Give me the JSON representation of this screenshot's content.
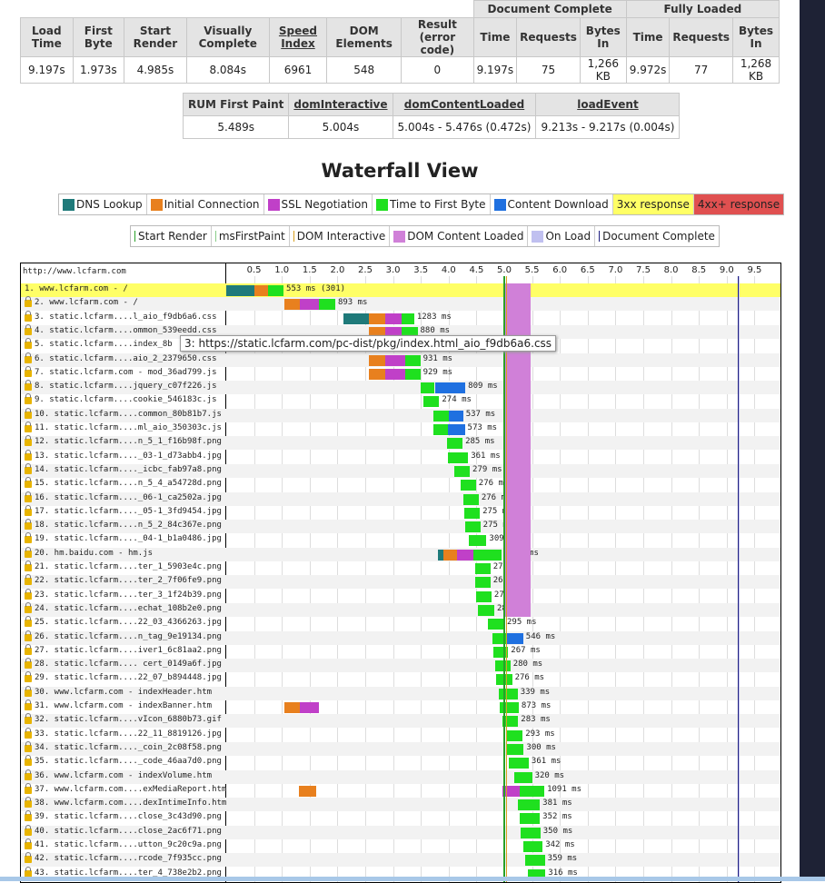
{
  "summary": {
    "group_headers": [
      "Document Complete",
      "Fully Loaded"
    ],
    "columns": [
      "Load Time",
      "First Byte",
      "Start Render",
      "Visually Complete",
      "Speed Index",
      "DOM Elements",
      "Result (error code)",
      "Time",
      "Requests",
      "Bytes In",
      "Time",
      "Requests",
      "Bytes In"
    ],
    "values": [
      "9.197s",
      "1.973s",
      "4.985s",
      "8.084s",
      "6961",
      "548",
      "0",
      "9.197s",
      "75",
      "1,266 KB",
      "9.972s",
      "77",
      "1,268 KB"
    ]
  },
  "rum": {
    "headers": [
      "RUM First Paint",
      "domInteractive",
      "domContentLoaded",
      "loadEvent"
    ],
    "values": [
      "5.489s",
      "5.004s",
      "5.004s - 5.476s (0.472s)",
      "9.213s - 9.217s (0.004s)"
    ]
  },
  "waterfall_title": "Waterfall View",
  "legend_timing": [
    {
      "label": "DNS Lookup",
      "color": "#1f7a7a"
    },
    {
      "label": "Initial Connection",
      "color": "#e8801e"
    },
    {
      "label": "SSL Negotiation",
      "color": "#c040c8"
    },
    {
      "label": "Time to First Byte",
      "color": "#1fe01f"
    },
    {
      "label": "Content Download",
      "color": "#1f70e0"
    },
    {
      "label": "3xx response",
      "color": "#ffff66"
    },
    {
      "label": "4xx+ response",
      "color": "#e05050"
    }
  ],
  "legend_events": [
    {
      "label": "Start Render",
      "color": "#28a028"
    },
    {
      "label": "msFirstPaint",
      "color": "#88cc88"
    },
    {
      "label": "DOM Interactive",
      "color": "#d8a020"
    },
    {
      "label": "DOM Content Loaded",
      "color": "#d080d8"
    },
    {
      "label": "On Load",
      "color": "#c0c0f0"
    },
    {
      "label": "Document Complete",
      "color": "#202080"
    }
  ],
  "waterfall": {
    "page_url": "http://www.lcfarm.com",
    "ticks": [
      "0.5",
      "1.0",
      "1.5",
      "2.0",
      "2.5",
      "3.0",
      "3.5",
      "4.0",
      "4.5",
      "5.0",
      "5.5",
      "6.0",
      "6.5",
      "7.0",
      "7.5",
      "8.0",
      "8.5",
      "9.0",
      "9.5"
    ],
    "events_s": {
      "start_render": 4.985,
      "dom_interactive": 5.004,
      "dom_content_loaded": [
        5.004,
        5.476
      ],
      "on_load": [
        9.213,
        9.217
      ],
      "document_complete": 9.197
    },
    "tooltip": "3: https://static.lcfarm.com/pc-dist/pkg/index.html_aio_f9db6a6.css",
    "rows": [
      {
        "label": "1. www.lcfarm.com - /",
        "duration": "553 ms (301)",
        "lock": false,
        "hi": true,
        "segs": [
          [
            0,
            0.5,
            "dns"
          ],
          [
            0.5,
            0.75,
            "conn"
          ],
          [
            0.75,
            1.03,
            "ttfb"
          ]
        ]
      },
      {
        "label": "2. www.lcfarm.com - /",
        "duration": "893 ms",
        "lock": true,
        "segs": [
          [
            1.05,
            1.33,
            "conn"
          ],
          [
            1.33,
            1.66,
            "ssl"
          ],
          [
            1.66,
            1.96,
            "ttfb"
          ]
        ]
      },
      {
        "label": "3. static.lcfarm....l_aio_f9db6a6.css",
        "duration": "1283 ms",
        "lock": true,
        "segs": [
          [
            2.1,
            2.56,
            "dns"
          ],
          [
            2.56,
            2.86,
            "conn"
          ],
          [
            2.86,
            3.16,
            "ssl"
          ],
          [
            3.16,
            3.38,
            "ttfb"
          ]
        ]
      },
      {
        "label": "4. static.lcfarm....ommon_539eedd.css",
        "duration": "880 ms",
        "lock": true,
        "segs": [
          [
            2.56,
            2.86,
            "conn"
          ],
          [
            2.86,
            3.16,
            "ssl"
          ],
          [
            3.16,
            3.44,
            "ttfb"
          ]
        ]
      },
      {
        "label": "5. static.lcfarm....index_8b",
        "duration": "",
        "lock": true,
        "segs": []
      },
      {
        "label": "6. static.lcfarm....aio_2_2379650.css",
        "duration": "931 ms",
        "lock": true,
        "segs": [
          [
            2.56,
            2.86,
            "conn"
          ],
          [
            2.86,
            3.22,
            "ssl"
          ],
          [
            3.22,
            3.49,
            "ttfb"
          ]
        ]
      },
      {
        "label": "7. static.lcfarm.com - mod_36ad799.js",
        "duration": "929 ms",
        "lock": true,
        "segs": [
          [
            2.56,
            2.86,
            "conn"
          ],
          [
            2.86,
            3.22,
            "ssl"
          ],
          [
            3.22,
            3.49,
            "ttfb"
          ]
        ]
      },
      {
        "label": "8. static.lcfarm....jquery_c07f226.js",
        "duration": "809 ms",
        "lock": true,
        "segs": [
          [
            3.5,
            3.75,
            "ttfb"
          ],
          [
            3.75,
            4.3,
            "download"
          ]
        ]
      },
      {
        "label": "9. static.lcfarm....cookie_546183c.js",
        "duration": "274 ms",
        "lock": true,
        "segs": [
          [
            3.55,
            3.83,
            "ttfb"
          ]
        ]
      },
      {
        "label": "10. static.lcfarm....common_80b81b7.js",
        "duration": "537 ms",
        "lock": true,
        "segs": [
          [
            3.72,
            4.0,
            "ttfb"
          ],
          [
            4.0,
            4.26,
            "download"
          ]
        ]
      },
      {
        "label": "11. static.lcfarm....ml_aio_350303c.js",
        "duration": "573 ms",
        "lock": true,
        "segs": [
          [
            3.72,
            3.98,
            "ttfb"
          ],
          [
            3.98,
            4.29,
            "download"
          ]
        ]
      },
      {
        "label": "12. static.lcfarm....n_5_1_f16b98f.png",
        "duration": "285 ms",
        "lock": true,
        "segs": [
          [
            3.97,
            4.25,
            "ttfb"
          ]
        ]
      },
      {
        "label": "13. static.lcfarm...._03-1_d73abb4.jpg",
        "duration": "361 ms",
        "lock": true,
        "segs": [
          [
            3.99,
            4.35,
            "ttfb"
          ]
        ]
      },
      {
        "label": "14. static.lcfarm...._icbc_fab97a8.png",
        "duration": "279 ms",
        "lock": true,
        "segs": [
          [
            4.1,
            4.38,
            "ttfb"
          ]
        ]
      },
      {
        "label": "15. static.lcfarm....n_5_4_a54728d.png",
        "duration": "276 ms",
        "lock": true,
        "segs": [
          [
            4.21,
            4.49,
            "ttfb"
          ]
        ]
      },
      {
        "label": "16. static.lcfarm...._06-1_ca2502a.jpg",
        "duration": "276 ms",
        "lock": true,
        "segs": [
          [
            4.26,
            4.54,
            "ttfb"
          ]
        ]
      },
      {
        "label": "17. static.lcfarm...._05-1_3fd9454.jpg",
        "duration": "275 ms",
        "lock": true,
        "segs": [
          [
            4.28,
            4.56,
            "ttfb"
          ]
        ]
      },
      {
        "label": "18. static.lcfarm....n_5_2_84c367e.png",
        "duration": "275 ms",
        "lock": true,
        "segs": [
          [
            4.29,
            4.57,
            "ttfb"
          ]
        ]
      },
      {
        "label": "19. static.lcfarm...._04-1_b1a0486.jpg",
        "duration": "309 ms",
        "lock": true,
        "segs": [
          [
            4.37,
            4.68,
            "ttfb"
          ]
        ]
      },
      {
        "label": "20. hm.baidu.com - hm.js",
        "duration": "1120 ms",
        "lock": true,
        "segs": [
          [
            3.8,
            3.9,
            "dns"
          ],
          [
            3.9,
            4.15,
            "conn"
          ],
          [
            4.15,
            4.45,
            "ssl"
          ],
          [
            4.45,
            4.95,
            "ttfb"
          ]
        ]
      },
      {
        "label": "21. static.lcfarm....ter_1_5903e4c.png",
        "duration": "279 ms",
        "lock": true,
        "segs": [
          [
            4.47,
            4.75,
            "ttfb"
          ]
        ]
      },
      {
        "label": "22. static.lcfarm....ter_2_7f06fe9.png",
        "duration": "268 ms",
        "lock": true,
        "segs": [
          [
            4.48,
            4.75,
            "ttfb"
          ]
        ]
      },
      {
        "label": "23. static.lcfarm....ter_3_1f24b39.png",
        "duration": "270 ms",
        "lock": true,
        "segs": [
          [
            4.5,
            4.77,
            "ttfb"
          ]
        ]
      },
      {
        "label": "24. static.lcfarm....echat_108b2e0.png",
        "duration": "287 ms",
        "lock": true,
        "segs": [
          [
            4.53,
            4.82,
            "ttfb"
          ]
        ]
      },
      {
        "label": "25. static.lcfarm....22_03_4366263.jpg",
        "duration": "295 ms",
        "lock": true,
        "segs": [
          [
            4.7,
            5.0,
            "ttfb"
          ]
        ]
      },
      {
        "label": "26. static.lcfarm....n_tag_9e19134.png",
        "duration": "546 ms",
        "lock": true,
        "segs": [
          [
            4.79,
            5.04,
            "ttfb"
          ],
          [
            5.04,
            5.34,
            "download"
          ]
        ]
      },
      {
        "label": "27. static.lcfarm....iver1_6c81aa2.png",
        "duration": "267 ms",
        "lock": true,
        "segs": [
          [
            4.8,
            5.07,
            "ttfb"
          ]
        ]
      },
      {
        "label": "28. static.lcfarm.... cert_0149a6f.jpg",
        "duration": "280 ms",
        "lock": true,
        "segs": [
          [
            4.83,
            5.11,
            "ttfb"
          ]
        ]
      },
      {
        "label": "29. static.lcfarm....22_07_b894448.jpg",
        "duration": "276 ms",
        "lock": true,
        "segs": [
          [
            4.86,
            5.14,
            "ttfb"
          ]
        ]
      },
      {
        "label": "30. www.lcfarm.com - indexHeader.htm",
        "duration": "339 ms",
        "lock": true,
        "segs": [
          [
            4.9,
            5.24,
            "ttfb"
          ]
        ]
      },
      {
        "label": "31. www.lcfarm.com - indexBanner.htm",
        "duration": "873 ms",
        "lock": true,
        "segs": [
          [
            1.05,
            1.33,
            "conn"
          ],
          [
            1.33,
            1.66,
            "ssl"
          ],
          [
            4.92,
            5.26,
            "ttfb"
          ]
        ]
      },
      {
        "label": "32. static.lcfarm....vIcon_6880b73.gif",
        "duration": "283 ms",
        "lock": true,
        "segs": [
          [
            4.97,
            5.25,
            "ttfb"
          ]
        ]
      },
      {
        "label": "33. static.lcfarm....22_11_8819126.jpg",
        "duration": "293 ms",
        "lock": true,
        "segs": [
          [
            5.03,
            5.33,
            "ttfb"
          ]
        ]
      },
      {
        "label": "34. static.lcfarm...._coin_2c08f58.png",
        "duration": "300 ms",
        "lock": true,
        "segs": [
          [
            5.05,
            5.35,
            "ttfb"
          ]
        ]
      },
      {
        "label": "35. static.lcfarm...._code_46aa7d0.png",
        "duration": "361 ms",
        "lock": true,
        "segs": [
          [
            5.08,
            5.44,
            "ttfb"
          ]
        ]
      },
      {
        "label": "36. www.lcfarm.com - indexVolume.htm",
        "duration": "320 ms",
        "lock": true,
        "segs": [
          [
            5.18,
            5.5,
            "ttfb"
          ]
        ]
      },
      {
        "label": "37. www.lcfarm.com....exMediaReport.htm",
        "duration": "1091 ms",
        "lock": true,
        "segs": [
          [
            1.3,
            1.62,
            "conn"
          ],
          [
            4.97,
            5.28,
            "ssl"
          ],
          [
            5.28,
            5.72,
            "ttfb"
          ]
        ]
      },
      {
        "label": "38. www.lcfarm.com....dexIntimeInfo.htm",
        "duration": "381 ms",
        "lock": true,
        "segs": [
          [
            5.25,
            5.64,
            "ttfb"
          ]
        ]
      },
      {
        "label": "39. static.lcfarm....close_3c43d90.png",
        "duration": "352 ms",
        "lock": true,
        "segs": [
          [
            5.28,
            5.64,
            "ttfb"
          ]
        ]
      },
      {
        "label": "40. static.lcfarm....close_2ac6f71.png",
        "duration": "350 ms",
        "lock": true,
        "segs": [
          [
            5.3,
            5.65,
            "ttfb"
          ]
        ]
      },
      {
        "label": "41. static.lcfarm....utton_9c20c9a.png",
        "duration": "342 ms",
        "lock": true,
        "segs": [
          [
            5.34,
            5.69,
            "ttfb"
          ]
        ]
      },
      {
        "label": "42. static.lcfarm....rcode_7f935cc.png",
        "duration": "359 ms",
        "lock": true,
        "segs": [
          [
            5.37,
            5.73,
            "ttfb"
          ]
        ]
      },
      {
        "label": "43. static.lcfarm....ter_4_738e2b2.png",
        "duration": "316 ms",
        "lock": true,
        "segs": [
          [
            5.42,
            5.74,
            "ttfb"
          ]
        ]
      }
    ]
  },
  "colors": {
    "dns": "#1f7a7a",
    "conn": "#e8801e",
    "ssl": "#c040c8",
    "ttfb": "#1fe01f",
    "download": "#1f70e0",
    "highlight": "#ffff66",
    "dcl": "#d080d8",
    "doc_complete": "#202080"
  }
}
